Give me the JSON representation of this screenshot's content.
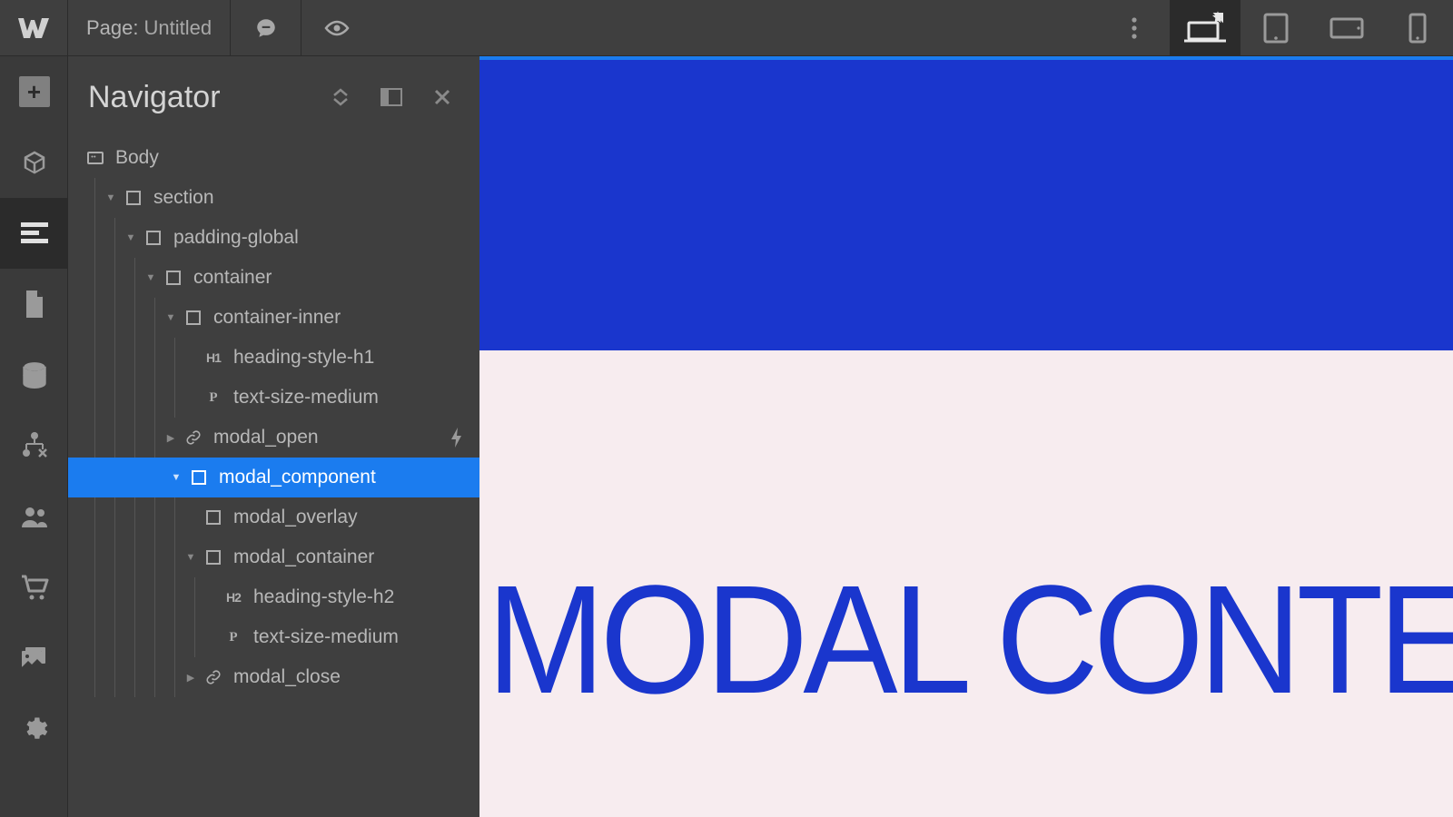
{
  "header": {
    "page_label": "Page:",
    "page_name": "Untitled"
  },
  "navigator": {
    "title": "Navigator",
    "tree": {
      "body": "Body",
      "section": "section",
      "padding_global": "padding-global",
      "container": "container",
      "container_inner": "container-inner",
      "heading_h1": "heading-style-h1",
      "text_medium_1": "text-size-medium",
      "modal_open": "modal_open",
      "modal_component": "modal_component",
      "modal_overlay": "modal_overlay",
      "modal_container": "modal_container",
      "heading_h2": "heading-style-h2",
      "text_medium_2": "text-size-medium",
      "modal_close": "modal_close"
    }
  },
  "canvas": {
    "heading": "MODAL CONTENT"
  }
}
